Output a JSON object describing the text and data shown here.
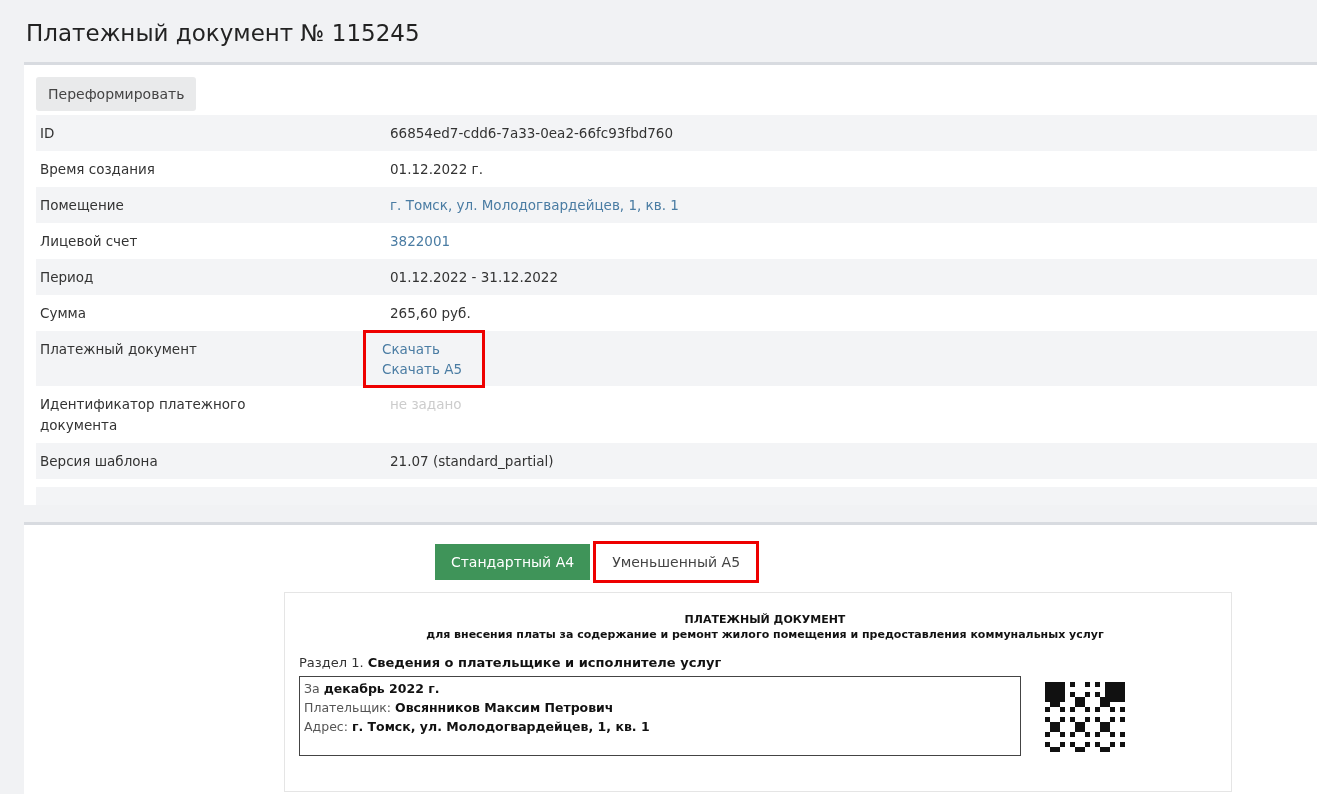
{
  "title": "Платежный документ № 115245",
  "reform_button": "Переформировать",
  "rows": [
    {
      "label": "ID",
      "kind": "text",
      "values": [
        "66854ed7-cdd6-7a33-0ea2-66fc93fbd760"
      ],
      "highlighted": false
    },
    {
      "label": "Время создания",
      "kind": "text",
      "values": [
        "01.12.2022 г."
      ],
      "highlighted": false
    },
    {
      "label": "Помещение",
      "kind": "link",
      "values": [
        "г. Томск, ул. Молодогвардейцев, 1, кв. 1"
      ],
      "highlighted": false
    },
    {
      "label": "Лицевой счет",
      "kind": "link",
      "values": [
        "3822001"
      ],
      "highlighted": false
    },
    {
      "label": "Период",
      "kind": "text",
      "values": [
        "01.12.2022 - 31.12.2022"
      ],
      "highlighted": false
    },
    {
      "label": "Сумма",
      "kind": "text",
      "values": [
        "265,60 руб."
      ],
      "highlighted": false
    },
    {
      "label": "Платежный документ",
      "kind": "link",
      "values": [
        "Скачать",
        "Скачать А5"
      ],
      "highlighted": true
    },
    {
      "label": "Идентификатор платежного документа",
      "kind": "muted",
      "values": [
        "не задано"
      ],
      "highlighted": false
    },
    {
      "label": "Версия шаблона",
      "kind": "text",
      "values": [
        "21.07 (standard_partial)"
      ],
      "highlighted": false
    }
  ],
  "format_tabs": [
    {
      "label": "Стандартный А4",
      "selected": true,
      "highlighted": false
    },
    {
      "label": "Уменьшенный А5",
      "selected": false,
      "highlighted": true
    }
  ],
  "document": {
    "heading": "ПЛАТЕЖНЫЙ ДОКУМЕНТ",
    "subheading": "для внесения платы за содержание и ремонт жилого помещения и предоставления коммунальных услуг",
    "section": "Раздел 1. **Сведения о плательщике и исполнителе услуг**",
    "lines": [
      "За **декабрь 2022 г.**",
      "Плательщик: **Овсянников Максим Петрович**",
      "Адрес: **г. Томск, ул. Молодогвардейцев, 1, кв. 1**"
    ]
  }
}
